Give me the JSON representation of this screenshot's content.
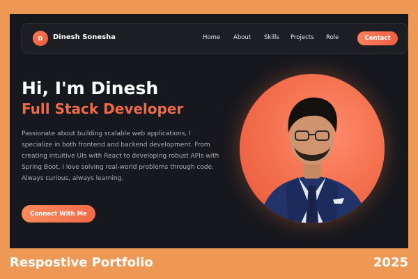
{
  "brand": {
    "initial": "D",
    "name": "Dinesh Sonesha"
  },
  "nav": {
    "links": [
      "Home",
      "About",
      "Skills",
      "Projects",
      "Role"
    ],
    "contact_label": "Contact"
  },
  "hero": {
    "greeting": "Hi, I'm Dinesh",
    "role": "Full Stack Developer",
    "description": "Passionate about building scalable web applications, I specialize in both frontend and backend development. From creating intuitive UIs with React to developing robust APIs with Spring Boot, I love solving real-world problems through code. Always curious, always learning.",
    "cta_label": "Connect With Me"
  },
  "footer_banner": {
    "title": "Respostive Portfolio",
    "year": "2025"
  },
  "colors": {
    "accent": "#f06a47",
    "background": "#16181d",
    "frame": "#ee9856"
  },
  "icons": {
    "profile": "profile-photo"
  }
}
